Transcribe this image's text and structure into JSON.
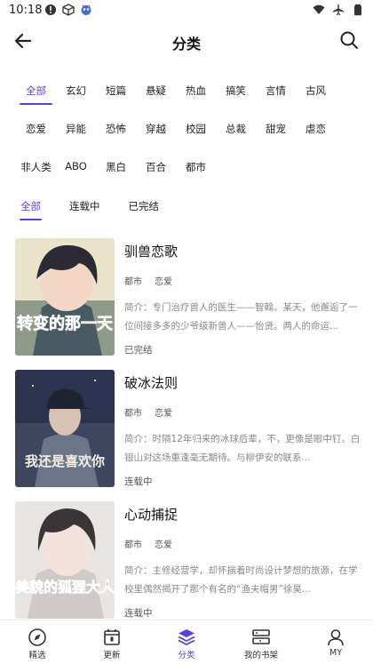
{
  "status_bar": {
    "time": "10:18"
  },
  "header": {
    "title": "分类"
  },
  "categories": [
    [
      "全部",
      "玄幻",
      "短篇",
      "悬疑",
      "热血",
      "搞笑",
      "言情",
      "古风"
    ],
    [
      "恋爱",
      "异能",
      "恐怖",
      "穿越",
      "校园",
      "总裁",
      "甜宠",
      "虐恋"
    ],
    [
      "非人类",
      "ABO",
      "黑白",
      "百合",
      "都市"
    ]
  ],
  "status_filters": [
    "全部",
    "连载中",
    "已完结"
  ],
  "books": [
    {
      "title": "驯兽恋歌",
      "tags": [
        "都市",
        "恋爱"
      ],
      "desc": "简介：专门治疗兽人的医生——智翰。某天，他邂逅了一位间接多多的少爷级新兽人——怡贤。两人的命运...",
      "status": "已完结",
      "cover_text": "转变的那一天"
    },
    {
      "title": "破冰法则",
      "tags": [
        "都市",
        "恋爱"
      ],
      "desc": "简介：时隔12年归来的冰球后辈，不，更像是眼中钉。白银山对这场重逢毫无期待。与柳伊安的联系...",
      "status": "连载中",
      "cover_text": "我还是喜欢你"
    },
    {
      "title": "心动捕捉",
      "tags": [
        "都市",
        "恋爱"
      ],
      "desc": "简介：主修经营学，却怀揣着时尚设计梦想的旅源，在学校里偶然揭开了那个有名的“渔夫帽男”徐昊...",
      "status": "连载中",
      "cover_text": "美貌的狐狸大人"
    }
  ],
  "bottom_nav": [
    {
      "label": "精选",
      "icon": "compass-icon"
    },
    {
      "label": "更新",
      "icon": "calendar-icon"
    },
    {
      "label": "分类",
      "icon": "layers-icon"
    },
    {
      "label": "我的书架",
      "icon": "bookshelf-icon"
    },
    {
      "label": "MY",
      "icon": "user-icon"
    }
  ],
  "colors": {
    "accent": "#5b3fd8"
  }
}
